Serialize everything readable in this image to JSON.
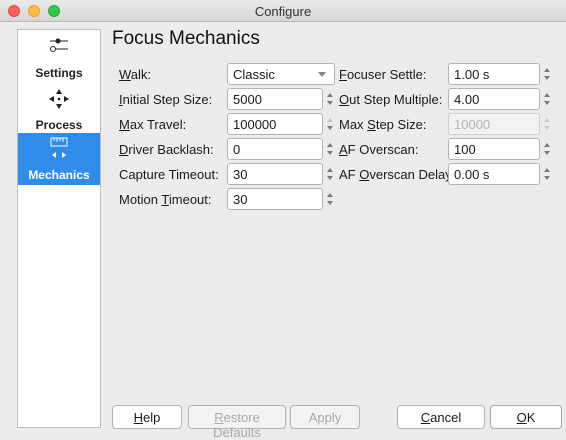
{
  "window": {
    "title": "Configure"
  },
  "sidebar": {
    "items": [
      {
        "label": "Settings",
        "icon": "sliders-icon",
        "active": false
      },
      {
        "label": "Process",
        "icon": "move-arrows-icon",
        "active": false
      },
      {
        "label": "Mechanics",
        "icon": "ruler-icon",
        "active": true
      }
    ]
  },
  "page": {
    "heading": "Focus Mechanics"
  },
  "fields": {
    "walk": {
      "label_pre": "",
      "label_u": "W",
      "label_post": "alk:",
      "value": "Classic"
    },
    "initial_step_size": {
      "label_pre": "",
      "label_u": "I",
      "label_post": "nitial Step Size:",
      "value": "5000"
    },
    "max_travel": {
      "label_pre": "",
      "label_u": "M",
      "label_post": "ax Travel:",
      "value": "100000"
    },
    "driver_backlash": {
      "label_pre": "",
      "label_u": "D",
      "label_post": "river Backlash:",
      "value": "0"
    },
    "capture_timeout": {
      "label_pre": "Capture Timeout:",
      "label_u": "",
      "label_post": "",
      "value": "30"
    },
    "motion_timeout": {
      "label_pre": "Motion ",
      "label_u": "T",
      "label_post": "imeout:",
      "value": "30"
    },
    "focuser_settle": {
      "label_pre": "",
      "label_u": "F",
      "label_post": "ocuser Settle:",
      "value": "1.00 s"
    },
    "out_step_multiple": {
      "label_pre": "",
      "label_u": "O",
      "label_post": "ut Step Multiple:",
      "value": "4.00"
    },
    "max_step_size": {
      "label_pre": "Max ",
      "label_u": "S",
      "label_post": "tep Size:",
      "value": "10000",
      "disabled": true
    },
    "af_overscan": {
      "label_pre": "",
      "label_u": "A",
      "label_post": "F Overscan:",
      "value": "100"
    },
    "af_overscan_delay": {
      "label_pre": "AF ",
      "label_u": "O",
      "label_post": "verscan Delay:",
      "value": "0.00 s"
    }
  },
  "buttons": {
    "help_u": "H",
    "help_rest": "elp",
    "restore_u": "R",
    "restore_rest": "estore Defaults",
    "apply": "Apply",
    "cancel_u": "C",
    "cancel_rest": "ancel",
    "ok_u": "O",
    "ok_rest": "K"
  }
}
